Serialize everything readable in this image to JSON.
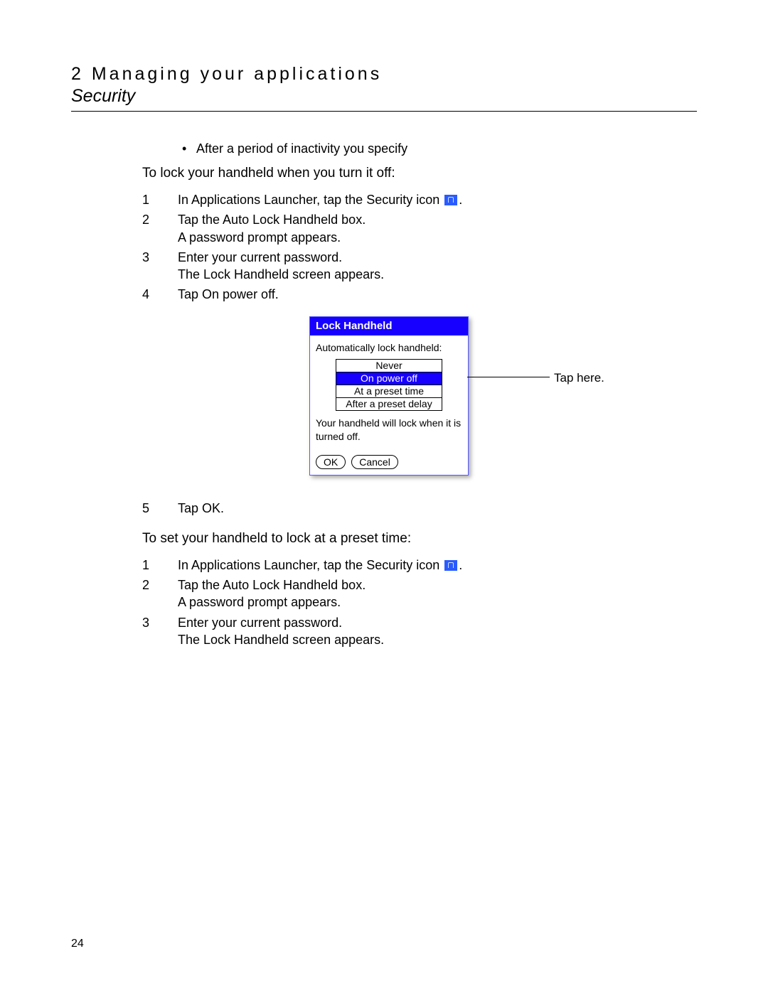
{
  "header": {
    "chapter": "2 Managing your applications",
    "section": "Security"
  },
  "bullet": "After a period of inactivity you specify",
  "subhead1": "To lock your handheld when you turn it off:",
  "steps1": [
    {
      "n": "1",
      "t": "In Applications Launcher, tap the Security icon",
      "icon": true,
      "tail": "."
    },
    {
      "n": "2",
      "t": "Tap the Auto Lock Handheld box.\nA password prompt appears."
    },
    {
      "n": "3",
      "t": "Enter your current password.\nThe Lock Handheld screen appears."
    },
    {
      "n": "4",
      "t": "Tap On power off."
    }
  ],
  "dialog": {
    "title": "Lock Handheld",
    "prompt": "Automatically lock handheld:",
    "options": [
      "Never",
      "On power off",
      "At a preset time",
      "After a preset delay"
    ],
    "selected": 1,
    "desc": "Your handheld will lock when it is turned off.",
    "ok": "OK",
    "cancel": "Cancel",
    "callout": "Tap here."
  },
  "step5": {
    "n": "5",
    "t": "Tap OK."
  },
  "subhead2": "To set your handheld to lock at a preset time:",
  "steps2": [
    {
      "n": "1",
      "t": "In Applications Launcher, tap the Security icon",
      "icon": true,
      "tail": "."
    },
    {
      "n": "2",
      "t": "Tap the Auto Lock Handheld box.\nA password prompt appears."
    },
    {
      "n": "3",
      "t": "Enter your current password.\nThe Lock Handheld screen appears."
    }
  ],
  "pageNumber": "24"
}
